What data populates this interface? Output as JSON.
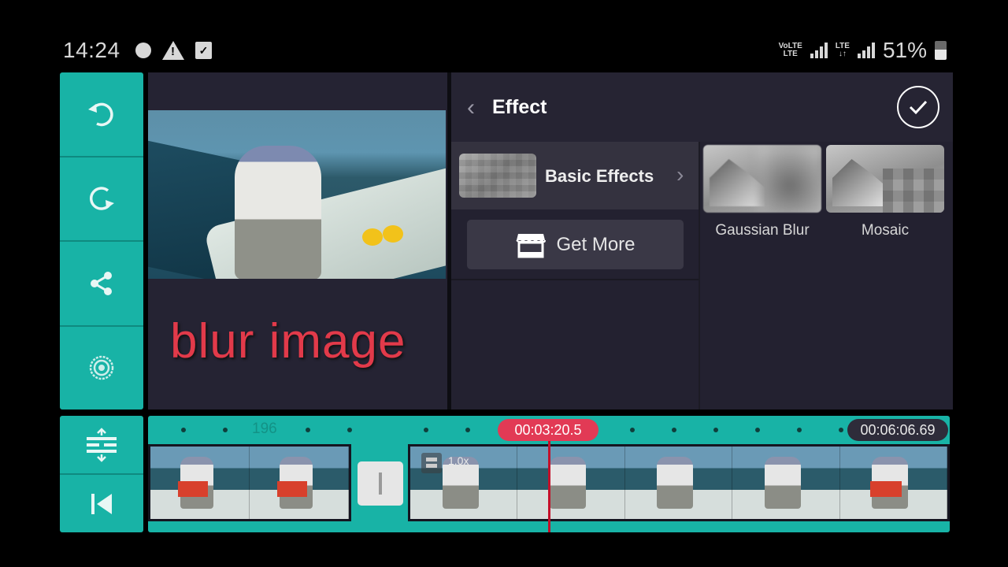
{
  "status_bar": {
    "time": "14:24",
    "left_icons": [
      "dot-notification-icon",
      "warning-icon",
      "checkbox-notification-icon"
    ],
    "net1": [
      "VoLTE",
      "LTE"
    ],
    "net2": [
      "LTE",
      "↓↑"
    ],
    "battery_percent": "51%"
  },
  "left_toolbar": {
    "buttons": [
      {
        "name": "undo",
        "icon": "undo-icon"
      },
      {
        "name": "redo",
        "icon": "redo-icon"
      },
      {
        "name": "share",
        "icon": "share-icon"
      },
      {
        "name": "settings",
        "icon": "settings-icon"
      }
    ]
  },
  "preview": {
    "overlay_text": "blur image"
  },
  "effect_panel": {
    "title": "Effect",
    "category": {
      "label": "Basic Effects"
    },
    "get_more_label": "Get More",
    "effects": [
      {
        "label": "Gaussian Blur"
      },
      {
        "label": "Mosaic"
      }
    ]
  },
  "timeline": {
    "ruler_label": "196",
    "playhead_time": "00:03:20.5",
    "total_time": "00:06:06.69",
    "playhead_fraction": 0.547,
    "clip_speed": "1.0x",
    "tools": [
      {
        "name": "expand-timeline",
        "icon": "expand-vertical-icon"
      },
      {
        "name": "jump-to-start",
        "icon": "skip-to-start-icon"
      }
    ]
  },
  "colors": {
    "accent_teal": "#18b3a6",
    "playhead_red": "#e23a55",
    "panel_bg": "#232130",
    "overlay_text_red": "#e23a4a"
  }
}
